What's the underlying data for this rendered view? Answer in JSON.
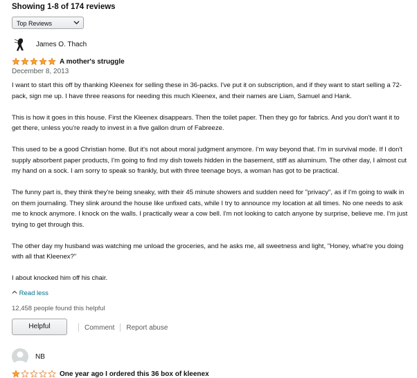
{
  "header": {
    "showing": "Showing 1-8 of 174 reviews",
    "sort_selected": "Top Reviews"
  },
  "review1": {
    "author": "James O. Thach",
    "rating": 5,
    "title": "A mother's struggle",
    "date": "December 8, 2013",
    "paragraphs": [
      "I want to start this off by thanking Kleenex for selling these in 36-packs. I've put it on subscription, and if they want to start selling a 72-pack, sign me up. I have three reasons for needing this much Kleenex, and their names are Liam, Samuel and Hank.",
      "This is how it goes in this house. First the Kleenex disappears. Then the toilet paper. Then they go for fabrics. And you don't want it to get there, unless you're ready to invest in a five gallon drum of Fabreeze.",
      "This used to be a good Christian home. But it's not about moral judgment anymore. I'm way beyond that. I'm in survival mode. If I don't supply absorbent paper products, I'm going to find my dish towels hidden in the basement, stiff as aluminum. The other day, I almost cut my hand on a sock. I am sorry to speak so frankly, but with three teenage boys, a woman has got to be practical.",
      "The funny part is, they think they're being sneaky, with their 45 minute showers and sudden need for \"privacy\", as if I'm going to walk in on them journaling. They slink around the house like unfixed cats, while I try to announce my location at all times. No one needs to ask me to knock anymore. I knock on the walls. I practically wear a cow bell. I'm not looking to catch anyone by surprise, believe me. I'm just trying to get through this.",
      "The other day my husband was watching me unload the groceries, and he asks me, all sweetness and light, \"Honey, what're you doing with all that Kleenex?\"",
      "I about knocked him off his chair."
    ],
    "read_less": "Read less",
    "helpful_count": "12,458 people found this helpful",
    "helpful_button": "Helpful",
    "comment": "Comment",
    "report": "Report abuse"
  },
  "review2": {
    "author": "NB",
    "rating": 1,
    "title_partial": "One year ago I ordered this 36 box of kleenex"
  },
  "colors": {
    "star": "#ffa41c",
    "link": "#007185",
    "muted": "#565959"
  }
}
